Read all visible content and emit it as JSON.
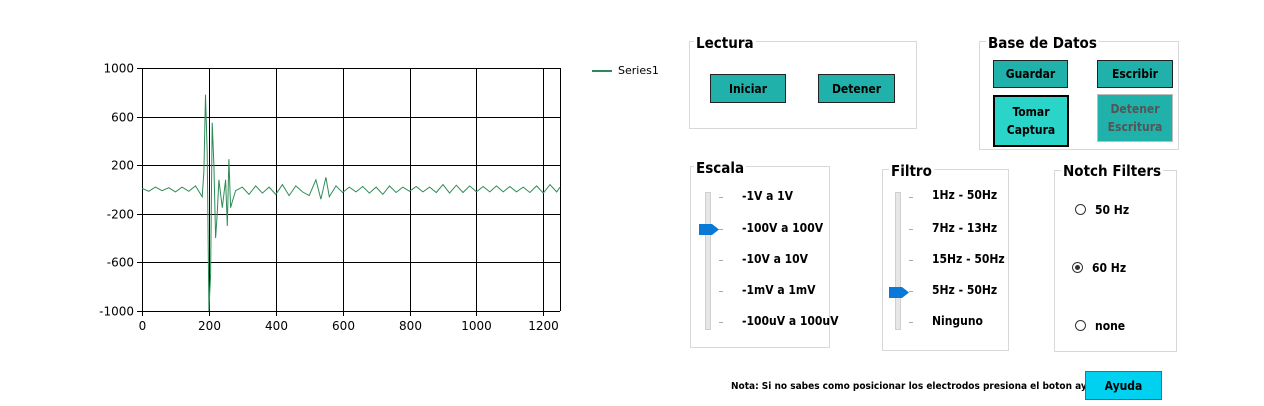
{
  "chart_data": {
    "type": "line",
    "xlim": [
      0,
      1250
    ],
    "ylim": [
      -1000,
      1000
    ],
    "x_ticks": [
      "0",
      "200",
      "400",
      "600",
      "800",
      "1000",
      "1200"
    ],
    "y_ticks": [
      "1000",
      "600",
      "200",
      "-200",
      "-600",
      "-1000"
    ],
    "grid": true,
    "legend_position": "top-right",
    "series": [
      {
        "name": "Series1",
        "color": "#2e8b57",
        "x": [
          0,
          20,
          40,
          60,
          80,
          100,
          120,
          140,
          160,
          180,
          185,
          190,
          195,
          200,
          205,
          210,
          215,
          220,
          225,
          230,
          240,
          250,
          255,
          260,
          265,
          270,
          280,
          300,
          320,
          340,
          360,
          380,
          400,
          420,
          440,
          460,
          480,
          500,
          520,
          535,
          550,
          560,
          580,
          600,
          620,
          640,
          660,
          680,
          700,
          720,
          740,
          760,
          780,
          800,
          820,
          840,
          860,
          880,
          900,
          920,
          940,
          960,
          980,
          1000,
          1020,
          1040,
          1060,
          1080,
          1100,
          1120,
          1140,
          1160,
          1180,
          1200,
          1220,
          1240,
          1250
        ],
        "values": [
          10,
          -15,
          20,
          -10,
          15,
          -20,
          20,
          -15,
          30,
          -60,
          150,
          780,
          300,
          -1000,
          -700,
          550,
          200,
          -400,
          -200,
          80,
          -150,
          80,
          -300,
          250,
          -150,
          -100,
          -10,
          20,
          -40,
          30,
          -30,
          20,
          -40,
          40,
          -50,
          30,
          -20,
          -50,
          80,
          -80,
          100,
          -60,
          30,
          -25,
          20,
          -20,
          25,
          -30,
          20,
          -40,
          30,
          -25,
          20,
          -15,
          25,
          -20,
          20,
          -25,
          40,
          -30,
          35,
          -25,
          30,
          -20,
          25,
          -20,
          30,
          -20,
          25,
          -20,
          20,
          -25,
          30,
          -30,
          40,
          -20,
          20
        ]
      }
    ]
  },
  "lectura": {
    "title": "Lectura",
    "iniciar": "Iniciar",
    "detener": "Detener"
  },
  "base_datos": {
    "title": "Base de Datos",
    "guardar": "Guardar",
    "escribir": "Escribir",
    "tomar_captura_1": "Tomar",
    "tomar_captura_2": "Captura",
    "detener_escritura_1": "Detener",
    "detener_escritura_2": "Escritura"
  },
  "escala": {
    "title": "Escala",
    "options": [
      "-1V a 1V",
      "-100V a 100V",
      "-10V a 10V",
      "-1mV a 1mV",
      "-100uV a 100uV"
    ],
    "selected": "-100V a 100V"
  },
  "filtro": {
    "title": "Filtro",
    "options": [
      "1Hz - 50Hz",
      "7Hz - 13Hz",
      "15Hz - 50Hz",
      "5Hz - 50Hz",
      "Ninguno"
    ],
    "selected": "5Hz - 50Hz"
  },
  "notch": {
    "title": "Notch Filters",
    "options": [
      "50 Hz",
      "60 Hz",
      "none"
    ],
    "selected": "60 Hz"
  },
  "footer": {
    "note": "Nota: Si no sabes como posicionar los electrodos presiona el boton ayuda -->",
    "ayuda": "Ayuda"
  },
  "colors": {
    "button": "#20b2aa",
    "help_button": "#00d1f0",
    "series": "#2e8b57",
    "thumb": "#0a78d7"
  }
}
